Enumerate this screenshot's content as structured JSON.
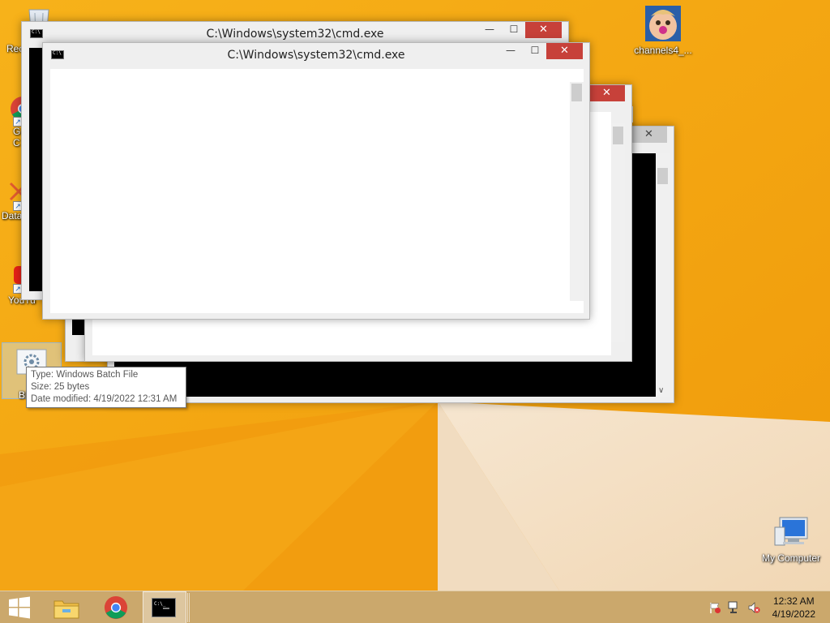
{
  "desktop": {
    "icons": [
      {
        "label": "Rec"
      },
      {
        "label": "G\nC"
      },
      {
        "label": "Data"
      },
      {
        "label": "YouTu"
      },
      {
        "label": "Bl"
      },
      {
        "label": "channels4_..."
      },
      {
        "label": "My Computer"
      }
    ]
  },
  "windows": [
    {
      "title": "C:\\Windows\\system32\\cmd.exe",
      "min": "—",
      "max": "☐",
      "close": "✕"
    },
    {
      "title": "C:\\Windows\\system32\\cmd.exe",
      "min": "—",
      "max": "☐",
      "close": "✕"
    },
    {
      "close": "✕"
    },
    {
      "close": "✕"
    },
    {
      "close": "✕"
    }
  ],
  "tooltip": {
    "type": "Type: Windows Batch File",
    "size": "Size: 25 bytes",
    "modified": "Date modified: 4/19/2022 12:31 AM"
  },
  "taskbar": {
    "items": [
      "start-icon",
      "file-explorer-icon",
      "chrome-icon",
      "cmd-icon"
    ],
    "tray": [
      "action-center-flag-icon",
      "network-icon",
      "volume-muted-icon"
    ],
    "time": "12:32 AM",
    "date": "4/19/2022"
  },
  "colors": {
    "wallpaper": "#f3a40f",
    "close_button": "#c7413a",
    "console_black": "#000000"
  }
}
